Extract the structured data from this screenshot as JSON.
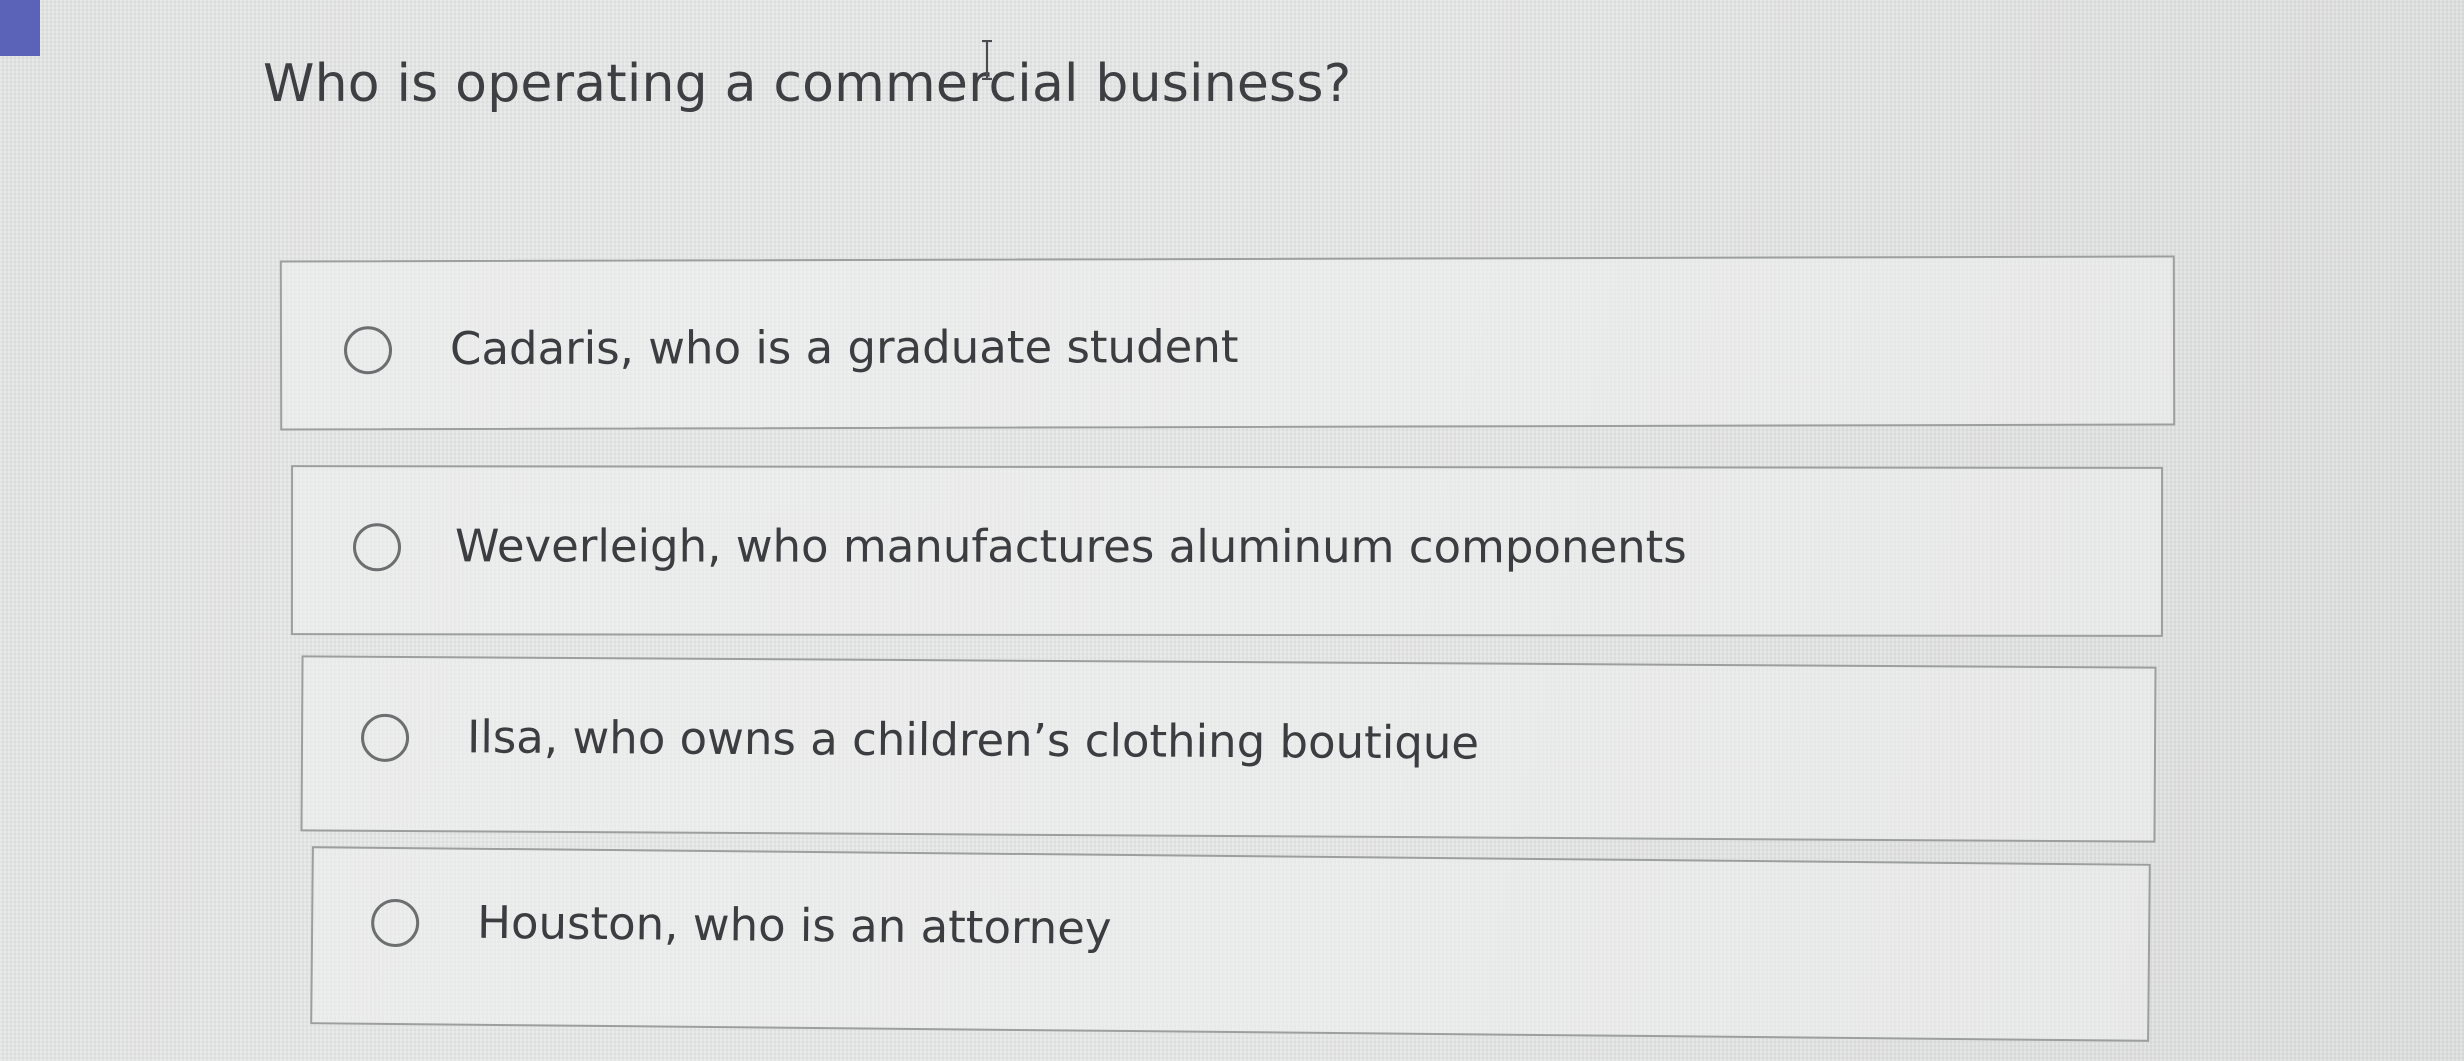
{
  "question": {
    "text": "Who is operating a commercial business?"
  },
  "options": [
    {
      "label": "Cadaris, who is a graduate student",
      "selected": false
    },
    {
      "label": "Weverleigh, who manufactures aluminum components",
      "selected": false
    },
    {
      "label": "Ilsa, who owns a children’s clothing boutique",
      "selected": false
    },
    {
      "label": "Houston, who is an attorney",
      "selected": false
    }
  ],
  "colors": {
    "accent": "#5b63b8",
    "border": "#9c9e9f",
    "text": "#3b3d40"
  },
  "icons": {
    "cursor": "text-cursor-icon",
    "radio": "radio-unchecked-icon"
  }
}
